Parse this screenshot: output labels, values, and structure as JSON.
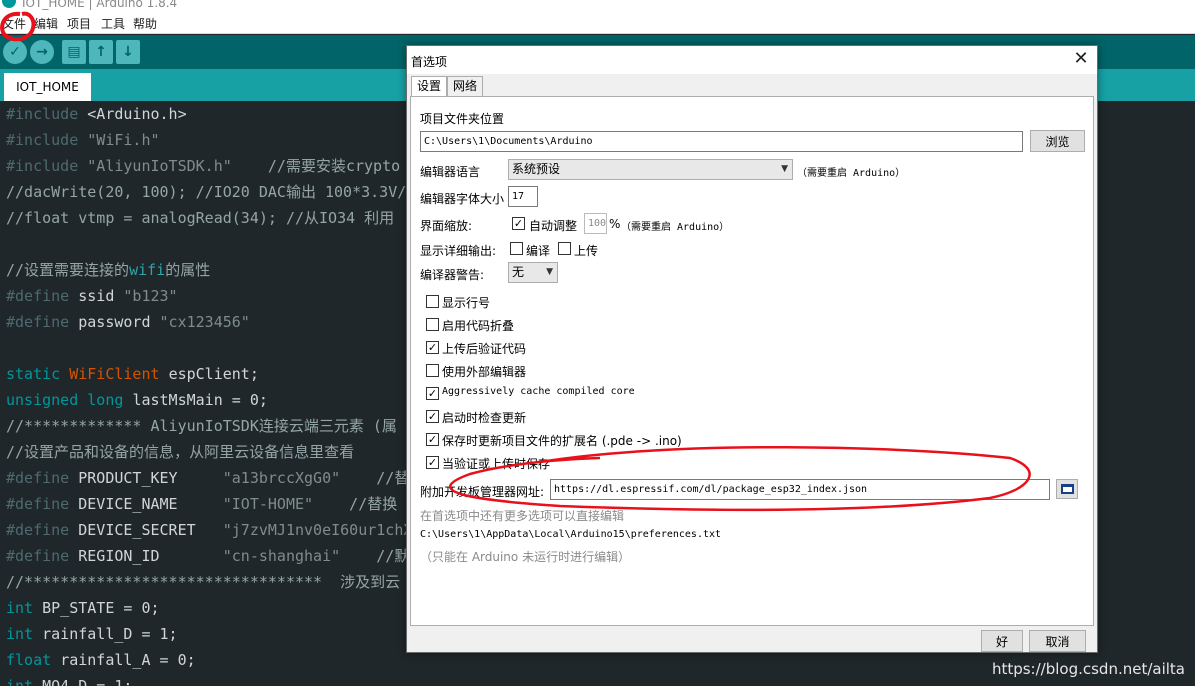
{
  "window": {
    "title": "IOT_HOME | Arduino 1.8.4"
  },
  "menu": [
    "文件",
    "编辑",
    "项目",
    "工具",
    "帮助"
  ],
  "toolbar": {
    "verify": "✓",
    "upload": "→",
    "new": "▤",
    "open": "↑",
    "save": "↓"
  },
  "tab": {
    "name": "IOT_HOME"
  },
  "code": [
    [
      [
        "c-pre",
        "#include "
      ],
      [
        "c-id",
        "<Arduino.h>"
      ]
    ],
    [
      [
        "c-pre",
        "#include "
      ],
      [
        "c-str",
        "\"WiFi.h\""
      ]
    ],
    [
      [
        "c-pre",
        "#include "
      ],
      [
        "c-str",
        "\"AliyunIoTSDK.h\""
      ],
      [
        "c-com",
        "    //需要安装crypto"
      ]
    ],
    [
      [
        "c-com",
        "//dacWrite(20, 100); //IO20 DAC输出 100*3.3V/"
      ]
    ],
    [
      [
        "c-com",
        "//float vtmp = analogRead(34); //从IO34 利用"
      ]
    ],
    [],
    [
      [
        "c-com",
        "//设置需要连接的"
      ],
      [
        "c-wi",
        "wifi"
      ],
      [
        "c-com",
        "的属性"
      ]
    ],
    [
      [
        "c-pre",
        "#define "
      ],
      [
        "c-id",
        "ssid "
      ],
      [
        "c-str",
        "\"b123\""
      ]
    ],
    [
      [
        "c-pre",
        "#define "
      ],
      [
        "c-id",
        "password "
      ],
      [
        "c-str",
        "\"cx123456\""
      ]
    ],
    [],
    [
      [
        "c-kw",
        "static "
      ],
      [
        "c-typ",
        "WiFiClient "
      ],
      [
        "c-id",
        "espClient;"
      ]
    ],
    [
      [
        "c-kw",
        "unsigned long "
      ],
      [
        "c-id",
        "lastMsMain = 0;"
      ]
    ],
    [
      [
        "c-com",
        "//************* AliyunIoTSDK连接云端三元素 (属"
      ]
    ],
    [
      [
        "c-com",
        "//设置产品和设备的信息，从阿里云设备信息里查看"
      ]
    ],
    [
      [
        "c-pre",
        "#define "
      ],
      [
        "c-id",
        "PRODUCT_KEY     "
      ],
      [
        "c-str",
        "\"a13brccXgG0\""
      ],
      [
        "c-com",
        "    //替"
      ]
    ],
    [
      [
        "c-pre",
        "#define "
      ],
      [
        "c-id",
        "DEVICE_NAME     "
      ],
      [
        "c-str",
        "\"IOT-HOME\""
      ],
      [
        "c-com",
        "    //替换"
      ]
    ],
    [
      [
        "c-pre",
        "#define "
      ],
      [
        "c-id",
        "DEVICE_SECRET   "
      ],
      [
        "c-str",
        "\"j7zvMJ1nv0eI60ur1chX"
      ]
    ],
    [
      [
        "c-pre",
        "#define "
      ],
      [
        "c-id",
        "REGION_ID       "
      ],
      [
        "c-str",
        "\"cn-shanghai\""
      ],
      [
        "c-com",
        "    //默"
      ]
    ],
    [
      [
        "c-com",
        "//*********************************  涉及到云"
      ]
    ],
    [
      [
        "c-kw",
        "int "
      ],
      [
        "c-id",
        "BP_STATE = 0;"
      ]
    ],
    [
      [
        "c-kw",
        "int "
      ],
      [
        "c-id",
        "rainfall_D = 1;"
      ]
    ],
    [
      [
        "c-kw",
        "float "
      ],
      [
        "c-id",
        "rainfall_A = 0;"
      ]
    ],
    [
      [
        "c-kw",
        "int "
      ],
      [
        "c-id",
        "MQ4_D = 1;"
      ]
    ]
  ],
  "dialog": {
    "title": "首选项",
    "close": "✕",
    "tabs": [
      "设置",
      "网络"
    ],
    "sketchbook_label": "项目文件夹位置",
    "sketchbook_path": "C:\\Users\\1\\Documents\\Arduino",
    "browse": "浏览",
    "language_label": "编辑器语言",
    "language_value": "系统预设",
    "language_note": "（需要重启 Arduino）",
    "fontsize_label": "编辑器字体大小",
    "fontsize_value": "17",
    "scale_label": "界面缩放:",
    "scale_auto": "自动调整",
    "scale_value": "100",
    "scale_unit": "%",
    "scale_note": "（需要重启 Arduino）",
    "verbose_label": "显示详细输出:",
    "verbose_compile": "编译",
    "verbose_upload": "上传",
    "warnings_label": "编译器警告:",
    "warnings_value": "无",
    "options": [
      {
        "label": "显示行号",
        "checked": false
      },
      {
        "label": "启用代码折叠",
        "checked": false
      },
      {
        "label": "上传后验证代码",
        "checked": true
      },
      {
        "label": "使用外部编辑器",
        "checked": false
      },
      {
        "label": "Aggressively cache compiled core",
        "checked": true
      },
      {
        "label": "启动时检查更新",
        "checked": true
      },
      {
        "label": "保存时更新项目文件的扩展名 (.pde -> .ino)",
        "checked": true
      },
      {
        "label": "当验证或上传时保存",
        "checked": true
      }
    ],
    "boards_url_label": "附加开发板管理器网址:",
    "boards_url_value": "https://dl.espressif.com/dl/package_esp32_index.json",
    "more_prefs": "在首选项中还有更多选项可以直接编辑",
    "prefs_path": "C:\\Users\\1\\AppData\\Local\\Arduino15\\preferences.txt",
    "prefs_note": "（只能在 Arduino 未运行时进行编辑）",
    "ok": "好",
    "cancel": "取消"
  },
  "watermark": "https://blog.csdn.net/ailta",
  "colors": {
    "arduino_teal": "#00979c",
    "toolbar": "#006468",
    "tabstrip": "#17a1a5",
    "annotation_red": "#e8101a"
  }
}
